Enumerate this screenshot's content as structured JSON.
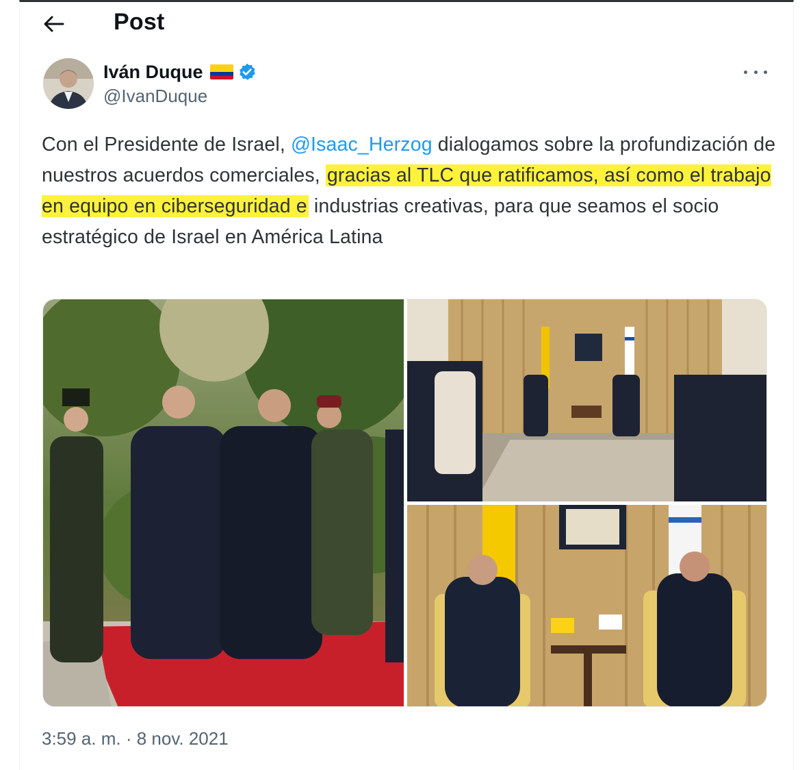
{
  "header": {
    "back_icon": "arrow-left-icon",
    "title": "Post"
  },
  "author": {
    "display_name": "Iván Duque",
    "handle": "@IvanDuque",
    "flag_icon": "colombia-flag-emoji",
    "verified_icon": "verified-badge-icon",
    "verified_color": "#1d9bf0"
  },
  "more_icon": "more-horizontal-icon",
  "tweet": {
    "text_1": "Con el Presidente de Israel, ",
    "mention": "@Isaac_Herzog",
    "text_2": " dialogamos sobre la profundización de nuestros acuerdos comerciales, ",
    "highlight": "gracias al TLC que ratificamos, así como el trabajo en equipo en ciberseguridad e",
    "text_3": " industrias creativas, para que seamos el socio estratégico de Israel en América Latina",
    "highlight_color": "#fff23a",
    "mention_color": "#1d9bf0"
  },
  "media": {
    "photos": [
      "Two leaders walking on a red carpet with military officers",
      "Delegations seated in a meeting room with flags",
      "Two leaders seated in armchairs with Colombian and Israeli flags"
    ]
  },
  "timestamp": "3:59 a. m. · 8 nov. 2021"
}
